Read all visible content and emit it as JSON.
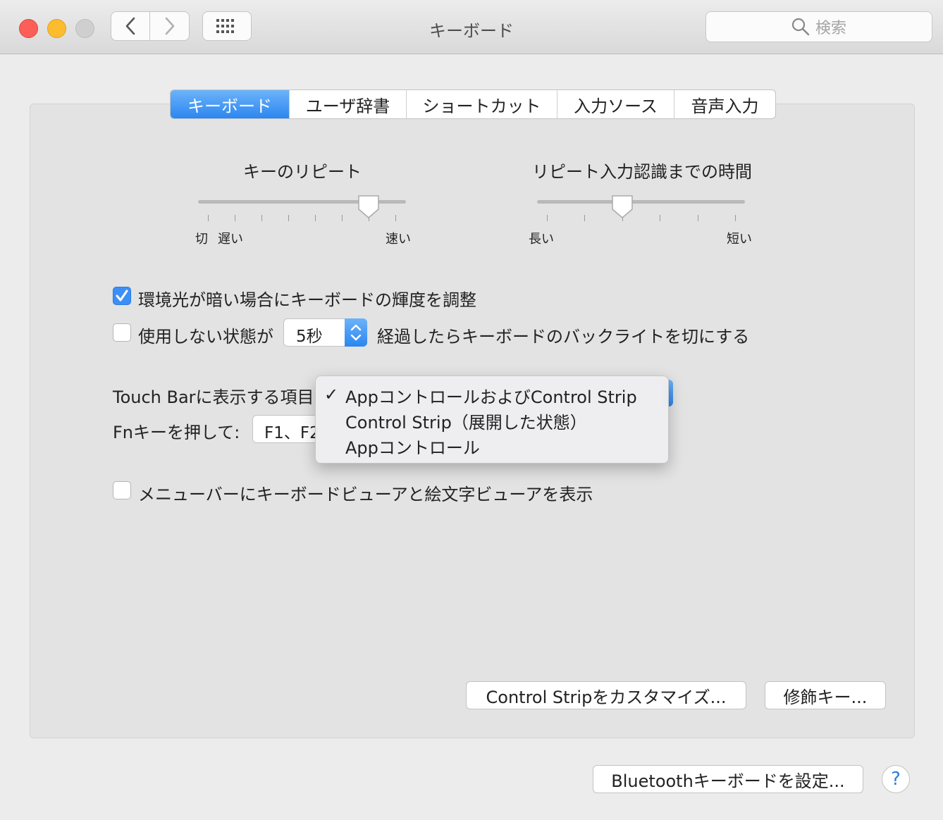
{
  "window": {
    "title": "キーボード",
    "search_placeholder": "検索"
  },
  "tabs": [
    {
      "label": "キーボード",
      "active": true
    },
    {
      "label": "ユーザ辞書",
      "active": false
    },
    {
      "label": "ショートカット",
      "active": false
    },
    {
      "label": "入力ソース",
      "active": false
    },
    {
      "label": "音声入力",
      "active": false
    }
  ],
  "key_repeat": {
    "title": "キーのリピート",
    "label_off": "切",
    "label_slow": "遅い",
    "label_fast": "速い",
    "level": 0.8
  },
  "delay_until_repeat": {
    "title": "リピート入力認識までの時間",
    "label_long": "長い",
    "label_short": "短い",
    "level": 0.4
  },
  "options": {
    "adjust_brightness_label": "環境光が暗い場合にキーボードの輝度を調整",
    "adjust_brightness_checked": true,
    "backlight_prefix": "使用しない状態が",
    "backlight_value": "5秒",
    "backlight_suffix": "経過したらキーボードのバックライトを切にする",
    "backlight_checked": false,
    "touchbar_label": "Touch Barに表示する項目",
    "fn_label": "Fnキーを押して:",
    "fn_value": "F1、F2",
    "viewer_label": "メニューバーにキーボードビューアと絵文字ビューアを表示",
    "viewer_checked": false
  },
  "touchbar_menu": {
    "check_glyph": "✓",
    "items": [
      {
        "label": "AppコントロールおよびControl Strip",
        "selected": true
      },
      {
        "label": "Control Strip（展開した状態）",
        "selected": false
      },
      {
        "label": "Appコントロール",
        "selected": false
      }
    ]
  },
  "buttons": {
    "customize_control_strip": "Control Stripをカスタマイズ...",
    "modifier_keys": "修飾キー...",
    "bluetooth_keyboard": "Bluetoothキーボードを設定...",
    "help": "?"
  },
  "colors": {
    "accent": "#2c86f0",
    "close": "#fc5f57",
    "minimize": "#fdbc2e"
  }
}
